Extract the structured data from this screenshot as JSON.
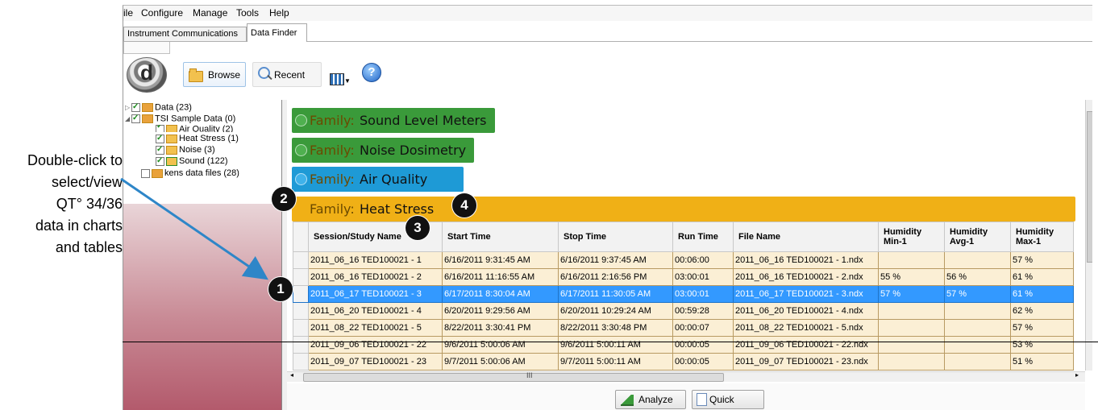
{
  "annotation": {
    "lines": [
      "Double-click to",
      "select/view",
      "QT° 34/36",
      "data in charts",
      "and tables"
    ]
  },
  "menu": [
    "ile",
    "Configure",
    "Manage",
    "Tools",
    "Help"
  ],
  "tabs": [
    "Instrument Communications",
    "Data Finder"
  ],
  "toolbar": {
    "logo_letter": "d",
    "browse_label": "Browse",
    "recent_label": "Recent",
    "help_glyph": "?"
  },
  "tree": [
    {
      "label": "Data (23)",
      "checked": true
    },
    {
      "label": "TSI Sample Data (0)",
      "checked": true
    },
    {
      "label": "Air Quality (2)",
      "checked": true
    },
    {
      "label": "Heat Stress (1)",
      "checked": true
    },
    {
      "label": "Noise (3)",
      "checked": true
    },
    {
      "label": "Sound (122)",
      "checked": true
    },
    {
      "label": "kens data files (28)",
      "checked": false
    }
  ],
  "families": [
    {
      "key": "Family:",
      "value": "Sound Level Meters",
      "color": "#3a9a3a"
    },
    {
      "key": "Family:",
      "value": "Noise Dosimetry",
      "color": "#3a9a3a"
    },
    {
      "key": "Family:",
      "value": "Air Quality",
      "color": "#1e9ad6"
    },
    {
      "key": "Family:",
      "value": "Heat Stress",
      "color": "#f0b016"
    }
  ],
  "grid": {
    "headers": [
      "Session/Study Name",
      "Start Time",
      "Stop Time",
      "Run Time",
      "File Name",
      "Humidity Min-1",
      "Humidity Avg-1",
      "Humidity Max-1"
    ],
    "rows": [
      [
        "2011_06_16 TED100021 - 1",
        "6/16/2011 9:31:45 AM",
        "6/16/2011 9:37:45 AM",
        "00:06:00",
        "2011_06_16 TED100021 - 1.ndx",
        "",
        "",
        "57 %"
      ],
      [
        "2011_06_16 TED100021 - 2",
        "6/16/2011 11:16:55 AM",
        "6/16/2011 2:16:56 PM",
        "03:00:01",
        "2011_06_16 TED100021 - 2.ndx",
        "55 %",
        "56 %",
        "61 %"
      ],
      [
        "2011_06_17 TED100021 - 3",
        "6/17/2011 8:30:04 AM",
        "6/17/2011 11:30:05 AM",
        "03:00:01",
        "2011_06_17 TED100021 - 3.ndx",
        "57 %",
        "57 %",
        "61 %"
      ],
      [
        "2011_06_20 TED100021 - 4",
        "6/20/2011 9:29:56 AM",
        "6/20/2011 10:29:24 AM",
        "00:59:28",
        "2011_06_20 TED100021 - 4.ndx",
        "",
        "",
        "62 %"
      ],
      [
        "2011_08_22 TED100021 - 5",
        "8/22/2011 3:30:41 PM",
        "8/22/2011 3:30:48 PM",
        "00:00:07",
        "2011_08_22 TED100021 - 5.ndx",
        "",
        "",
        "57 %"
      ],
      [
        "2011_09_06 TED100021 - 22",
        "9/6/2011 5:00:06 AM",
        "9/6/2011 5:00:11 AM",
        "00:00:05",
        "2011_09_06 TED100021 - 22.ndx",
        "",
        "",
        "53 %"
      ],
      [
        "2011_09_07 TED100021 - 23",
        "9/7/2011 5:00:06 AM",
        "9/7/2011 5:00:11 AM",
        "00:00:05",
        "2011_09_07 TED100021 - 23.ndx",
        "",
        "",
        "51 %"
      ]
    ],
    "selected_row": 2
  },
  "scroll_grip": "III",
  "buttons": {
    "analyze": "Analyze",
    "quick_report": "Quick Report"
  },
  "badges": [
    "1",
    "2",
    "3",
    "4"
  ]
}
